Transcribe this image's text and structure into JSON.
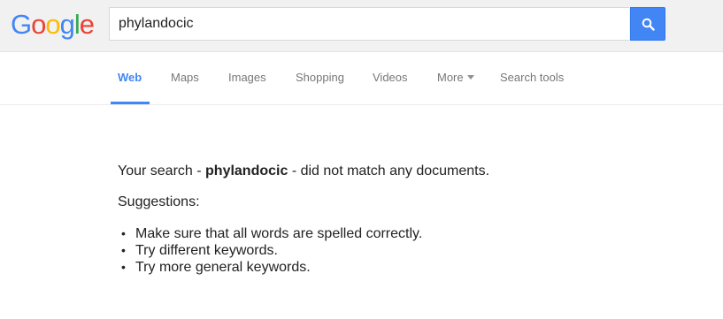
{
  "logo": {
    "letters": [
      {
        "char": "G",
        "color": "#4285f4"
      },
      {
        "char": "o",
        "color": "#ea4335"
      },
      {
        "char": "o",
        "color": "#fbbc05"
      },
      {
        "char": "g",
        "color": "#4285f4"
      },
      {
        "char": "l",
        "color": "#34a853"
      },
      {
        "char": "e",
        "color": "#ea4335"
      }
    ]
  },
  "search": {
    "value": "phylandocic",
    "button_icon": "search-icon"
  },
  "nav": {
    "tabs": [
      {
        "label": "Web",
        "active": true
      },
      {
        "label": "Maps",
        "active": false
      },
      {
        "label": "Images",
        "active": false
      },
      {
        "label": "Shopping",
        "active": false
      },
      {
        "label": "Videos",
        "active": false
      },
      {
        "label": "More",
        "active": false,
        "has_dropdown": true
      },
      {
        "label": "Search tools",
        "active": false
      }
    ]
  },
  "results": {
    "no_match_prefix": "Your search - ",
    "query": "phylandocic",
    "no_match_suffix": " - did not match any documents.",
    "suggestions_title": "Suggestions:",
    "suggestions": [
      "Make sure that all words are spelled correctly.",
      "Try different keywords.",
      "Try more general keywords."
    ],
    "bullet": "•"
  },
  "colors": {
    "accent": "#4285f4",
    "header_bg": "#f1f1f1",
    "tab_text": "#777777",
    "body_text": "#222222"
  }
}
